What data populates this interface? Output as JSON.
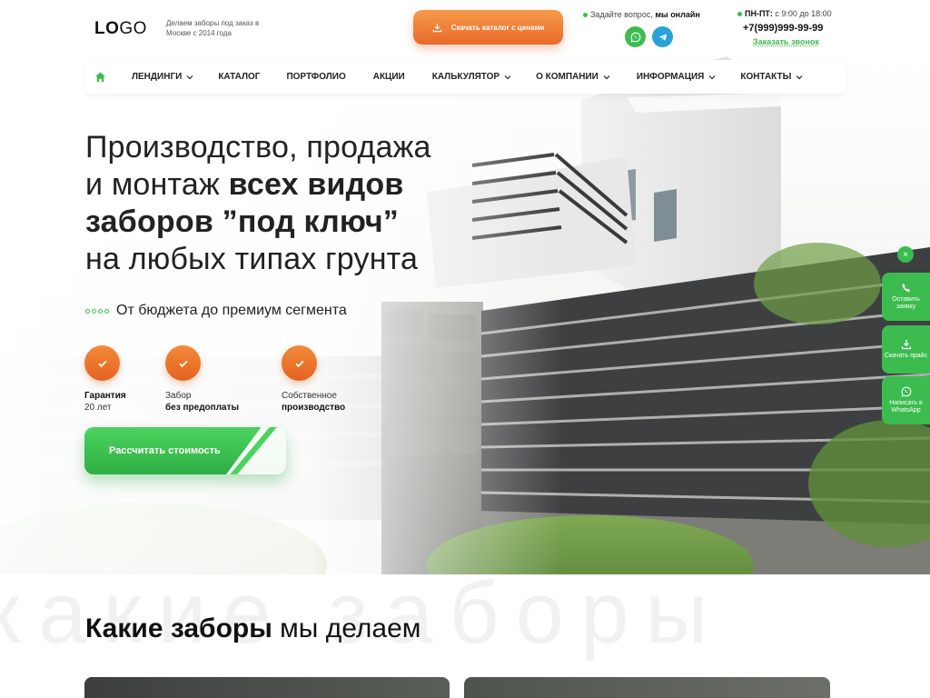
{
  "header": {
    "logo_bold": "LO",
    "logo_regular": "GO",
    "tagline": "Делаем заборы под заказ в Москве с 2014 года",
    "catalog_button": "Скачать каталог с ценами",
    "ask_text": "Задайте вопрос,",
    "ask_online": "мы онлайн",
    "hours_label": "ПН-ПТ:",
    "hours_value": "с 9:00 до 18:00",
    "phone": "+7(999)999-99-99",
    "callback": "Заказать звонок",
    "messenger_icons": [
      "whatsapp-icon",
      "telegram-icon"
    ]
  },
  "nav": {
    "items": [
      {
        "label": "ЛЕНДИНГИ",
        "dropdown": true
      },
      {
        "label": "КАТАЛОГ",
        "dropdown": false
      },
      {
        "label": "ПОРТФОЛИО",
        "dropdown": false
      },
      {
        "label": "АКЦИИ",
        "dropdown": false
      },
      {
        "label": "КАЛЬКУЛЯТОР",
        "dropdown": true
      },
      {
        "label": "О КОМПАНИИ",
        "dropdown": true
      },
      {
        "label": "ИНФОРМАЦИЯ",
        "dropdown": true
      },
      {
        "label": "КОНТАКТЫ",
        "dropdown": true
      }
    ]
  },
  "hero": {
    "line1": "Производство, продажа",
    "line2_regular": "и монтаж ",
    "line2_bold": "всех видов",
    "line3_bold": "заборов ”под ключ”",
    "line4": "на любых типах грунта",
    "subline": "От бюджета до премиум сегмента",
    "features": [
      {
        "line1": "Гарантия",
        "line2": "20 лет"
      },
      {
        "line1": "Забор",
        "line2": "без предоплаты"
      },
      {
        "line1": "Собственное",
        "line2": "производство"
      }
    ],
    "cta": "Рассчитать стоимость"
  },
  "side_widget": {
    "close": "×",
    "buttons": [
      {
        "label": "Оставить заявку",
        "icon": "phone-icon"
      },
      {
        "label": "Скачать прайс",
        "icon": "download-icon"
      },
      {
        "label": "Написать в WhatsApp",
        "icon": "whatsapp-icon"
      }
    ]
  },
  "section": {
    "watermark": "какие заборы",
    "title_bold": "Какие заборы",
    "title_regular": " мы делаем"
  },
  "colors": {
    "accent_green": "#3cbc4f",
    "accent_orange": "#e8692a",
    "telegram": "#2aa3d9"
  }
}
